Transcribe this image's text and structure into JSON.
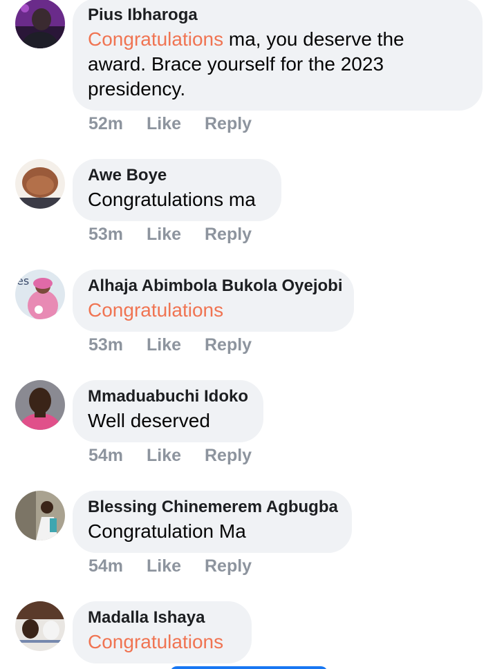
{
  "comments": [
    {
      "author": "Pius Ibharoga",
      "highlight": "Congratulations",
      "text": " ma, you deserve the award. Brace yourself for the 2023 presidency.",
      "time": "52m",
      "like_label": "Like",
      "reply_label": "Reply"
    },
    {
      "author": "Awe Boye",
      "highlight": "",
      "text": "Congratulations ma",
      "time": "53m",
      "like_label": "Like",
      "reply_label": "Reply"
    },
    {
      "author": "Alhaja Abimbola Bukola Oyejobi",
      "highlight": "Congratulations",
      "text": "",
      "time": "53m",
      "like_label": "Like",
      "reply_label": "Reply"
    },
    {
      "author": "Mmaduabuchi Idoko",
      "highlight": "",
      "text": "Well deserved",
      "time": "54m",
      "like_label": "Like",
      "reply_label": "Reply"
    },
    {
      "author": "Blessing Chinemerem Agbugba",
      "highlight": "",
      "text": "Congratulation Ma",
      "time": "54m",
      "like_label": "Like",
      "reply_label": "Reply"
    },
    {
      "author": "Madalla Ishaya",
      "highlight": "Congratulations",
      "text": "",
      "time": "",
      "like_label": "",
      "reply_label": ""
    }
  ],
  "colors": {
    "bubble_bg": "#f0f2f5",
    "highlight": "#f07452",
    "meta": "#8d949e",
    "author": "#1c1e21",
    "accent_button": "#1877f2"
  },
  "icons": [
    "avatar-icon"
  ]
}
